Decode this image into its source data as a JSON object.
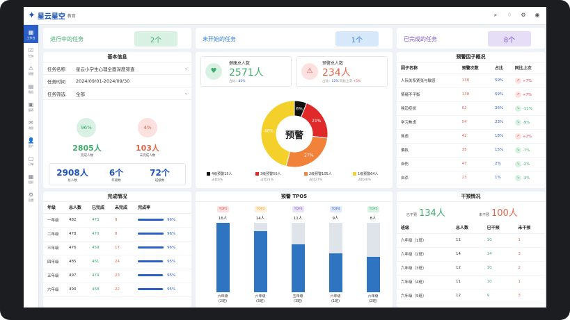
{
  "app": {
    "title": "星云星空",
    "subtitle": "教育"
  },
  "sidebar": [
    {
      "icon": "grid-icon",
      "label": "工作台",
      "glyph": "▦"
    },
    {
      "icon": "task-icon",
      "label": "任务",
      "glyph": "☑"
    },
    {
      "icon": "warning-icon",
      "label": "预警",
      "glyph": "⚠"
    },
    {
      "icon": "report-icon",
      "label": "报告",
      "glyph": "▤"
    },
    {
      "icon": "scale-icon",
      "label": "量表",
      "glyph": "▣"
    },
    {
      "icon": "mail-icon",
      "label": "消息",
      "glyph": "✉"
    },
    {
      "icon": "user-icon",
      "label": "用户",
      "glyph": "👤"
    },
    {
      "icon": "order-icon",
      "label": "订单",
      "glyph": "▢"
    },
    {
      "icon": "org-icon",
      "label": "组织",
      "glyph": "▦"
    },
    {
      "icon": "settings-icon",
      "label": "设置",
      "glyph": "⚙"
    }
  ],
  "summary": [
    {
      "label": "进行中的任务",
      "value": "2个",
      "color": "#3fae6c",
      "bg": "#d9f1e3"
    },
    {
      "label": "未开始的任务",
      "value": "1个",
      "color": "#2b7ad6",
      "bg": "#d7e8fb"
    },
    {
      "label": "已完成的任务",
      "value": "8个",
      "color": "#7d56c9",
      "bg": "#e6def7"
    }
  ],
  "basic": {
    "title": "基本信息",
    "fields": [
      {
        "label": "任务名称",
        "value": "星云小学生心理全面深度筛查"
      },
      {
        "label": "任务时间",
        "value": "2024/09/01-2024/09/30"
      },
      {
        "label": "任务筛选",
        "value": "全部"
      }
    ],
    "done_pct": "96%",
    "undone_pct": "4%",
    "done_num": "2805人",
    "done_label": "完成人数",
    "undone_num": "103人",
    "undone_label": "未完成人数",
    "total_num": "2908人",
    "total_label": "总人数",
    "grade_num": "6个",
    "grade_label": "年级数",
    "class_num": "72个",
    "class_label": "班级数"
  },
  "health": {
    "healthy_label": "健康总人数",
    "healthy_value": "2571人",
    "healthy_ratio_label": "占比：",
    "healthy_ratio": "85%",
    "warn_label": "预警总人数",
    "warn_value": "234人",
    "warn_ratio_label": "占比：",
    "warn_ratio": "12%",
    "warn_cmp_label": "同比上次",
    "warn_cmp": "+5%",
    "donut_center": "预警",
    "donut": [
      {
        "name": "4级预警15人",
        "pct": 6,
        "label": "6%",
        "color": "#111111",
        "sub": "占比6%"
      },
      {
        "name": "3级预警50人",
        "pct": 21,
        "label": "21%",
        "color": "#e02a2a",
        "sub": "占比21%"
      },
      {
        "name": "2级预警105人",
        "pct": 27,
        "label": "27%",
        "color": "#f0823a",
        "sub": "占比27%"
      },
      {
        "name": "1级预警64人",
        "pct": 46,
        "label": "46%",
        "color": "#f4d02a",
        "sub": "占比46%"
      }
    ]
  },
  "factors": {
    "title": "预警因子概况",
    "headers": [
      "因子名称",
      "预警次数",
      "占比",
      "同比上次"
    ],
    "rows": [
      {
        "name": "人际关系紧张与敏感",
        "count": "138",
        "ratio": "59%",
        "trend": "+7%",
        "up": true
      },
      {
        "name": "情绪不平衡",
        "count": "138",
        "ratio": "59%",
        "trend": "+7%",
        "up": true
      },
      {
        "name": "强迫症状",
        "count": "62",
        "ratio": "26%",
        "trend": "-11%",
        "up": false
      },
      {
        "name": "学习焦虑",
        "count": "54",
        "ratio": "23%",
        "trend": "-9%",
        "up": false
      },
      {
        "name": "焦虑",
        "count": "42",
        "ratio": "18%",
        "trend": "+2%",
        "up": true
      },
      {
        "name": "偏执",
        "count": "35",
        "ratio": "15%",
        "trend": "-7%",
        "up": false
      },
      {
        "name": "自伤",
        "count": "47",
        "ratio": "2%",
        "trend": "-2%",
        "up": false
      },
      {
        "name": "自杀",
        "count": "23",
        "ratio": "1%",
        "trend": "-3%",
        "up": false
      }
    ]
  },
  "completion": {
    "title": "完成情况",
    "headers": [
      "年级",
      "总人数",
      "已完成",
      "未完成",
      "完成率"
    ],
    "rows": [
      {
        "grade": "一年级",
        "total": "482",
        "done": "473",
        "undone": "9",
        "rate": "96%",
        "pct": 96
      },
      {
        "grade": "二年级",
        "total": "478",
        "done": "470",
        "undone": "8",
        "rate": "96%",
        "pct": 96
      },
      {
        "grade": "三年级",
        "total": "476",
        "done": "459",
        "undone": "17",
        "rate": "96%",
        "pct": 96
      },
      {
        "grade": "四年级",
        "total": "485",
        "done": "461",
        "undone": "24",
        "rate": "95%",
        "pct": 95
      },
      {
        "grade": "五年级",
        "total": "497",
        "done": "474",
        "undone": "23",
        "rate": "95%",
        "pct": 95
      },
      {
        "grade": "六年级",
        "total": "490",
        "done": "468",
        "undone": "22",
        "rate": "95%",
        "pct": 95
      }
    ]
  },
  "tpo": {
    "title": "预警 TPO5",
    "items": [
      {
        "tag": "TOP1",
        "count": "16人",
        "cls": "六年级\n(2班)",
        "ratio": 0.75,
        "tagbg": "#fde1e1",
        "tagc": "#e04b4b"
      },
      {
        "tag": "TOP2",
        "count": "14人",
        "cls": "六年级\n(3班)",
        "ratio": 0.66,
        "tagbg": "#fff0d6",
        "tagc": "#e89a2a"
      },
      {
        "tag": "TOP3",
        "count": "11人",
        "cls": "五年级\n(3班)",
        "ratio": 0.52,
        "tagbg": "#ebe2f8",
        "tagc": "#7d56c9"
      },
      {
        "tag": "TOP4",
        "count": "9人",
        "cls": "六年级\n(1班)",
        "ratio": 0.42,
        "tagbg": "#dfe8fb",
        "tagc": "#2b5fc6"
      },
      {
        "tag": "TOP5",
        "count": "8人",
        "cls": "六年级\n(2班)",
        "ratio": 0.38,
        "tagbg": "#d9f1e3",
        "tagc": "#3fae6c"
      }
    ]
  },
  "intervention": {
    "title": "干预情况",
    "done_label": "已干预",
    "done_value": "134人",
    "undone_label": "未干预",
    "undone_value": "100人",
    "headers": [
      "班级",
      "总人数",
      "已干预",
      "未干预"
    ],
    "rows": [
      {
        "cls": "六年级（1班）",
        "total": "11",
        "done": "10",
        "undone": "1"
      },
      {
        "cls": "六年级（2班）",
        "total": "14",
        "done": "14",
        "undone": "3"
      },
      {
        "cls": "六年级（3班）",
        "total": "12",
        "done": "10",
        "undone": "2"
      },
      {
        "cls": "六年级（4班）",
        "total": "11",
        "done": "10",
        "undone": "1"
      },
      {
        "cls": "六年级（5班）",
        "total": "12",
        "done": "9",
        "undone": "3"
      }
    ]
  }
}
